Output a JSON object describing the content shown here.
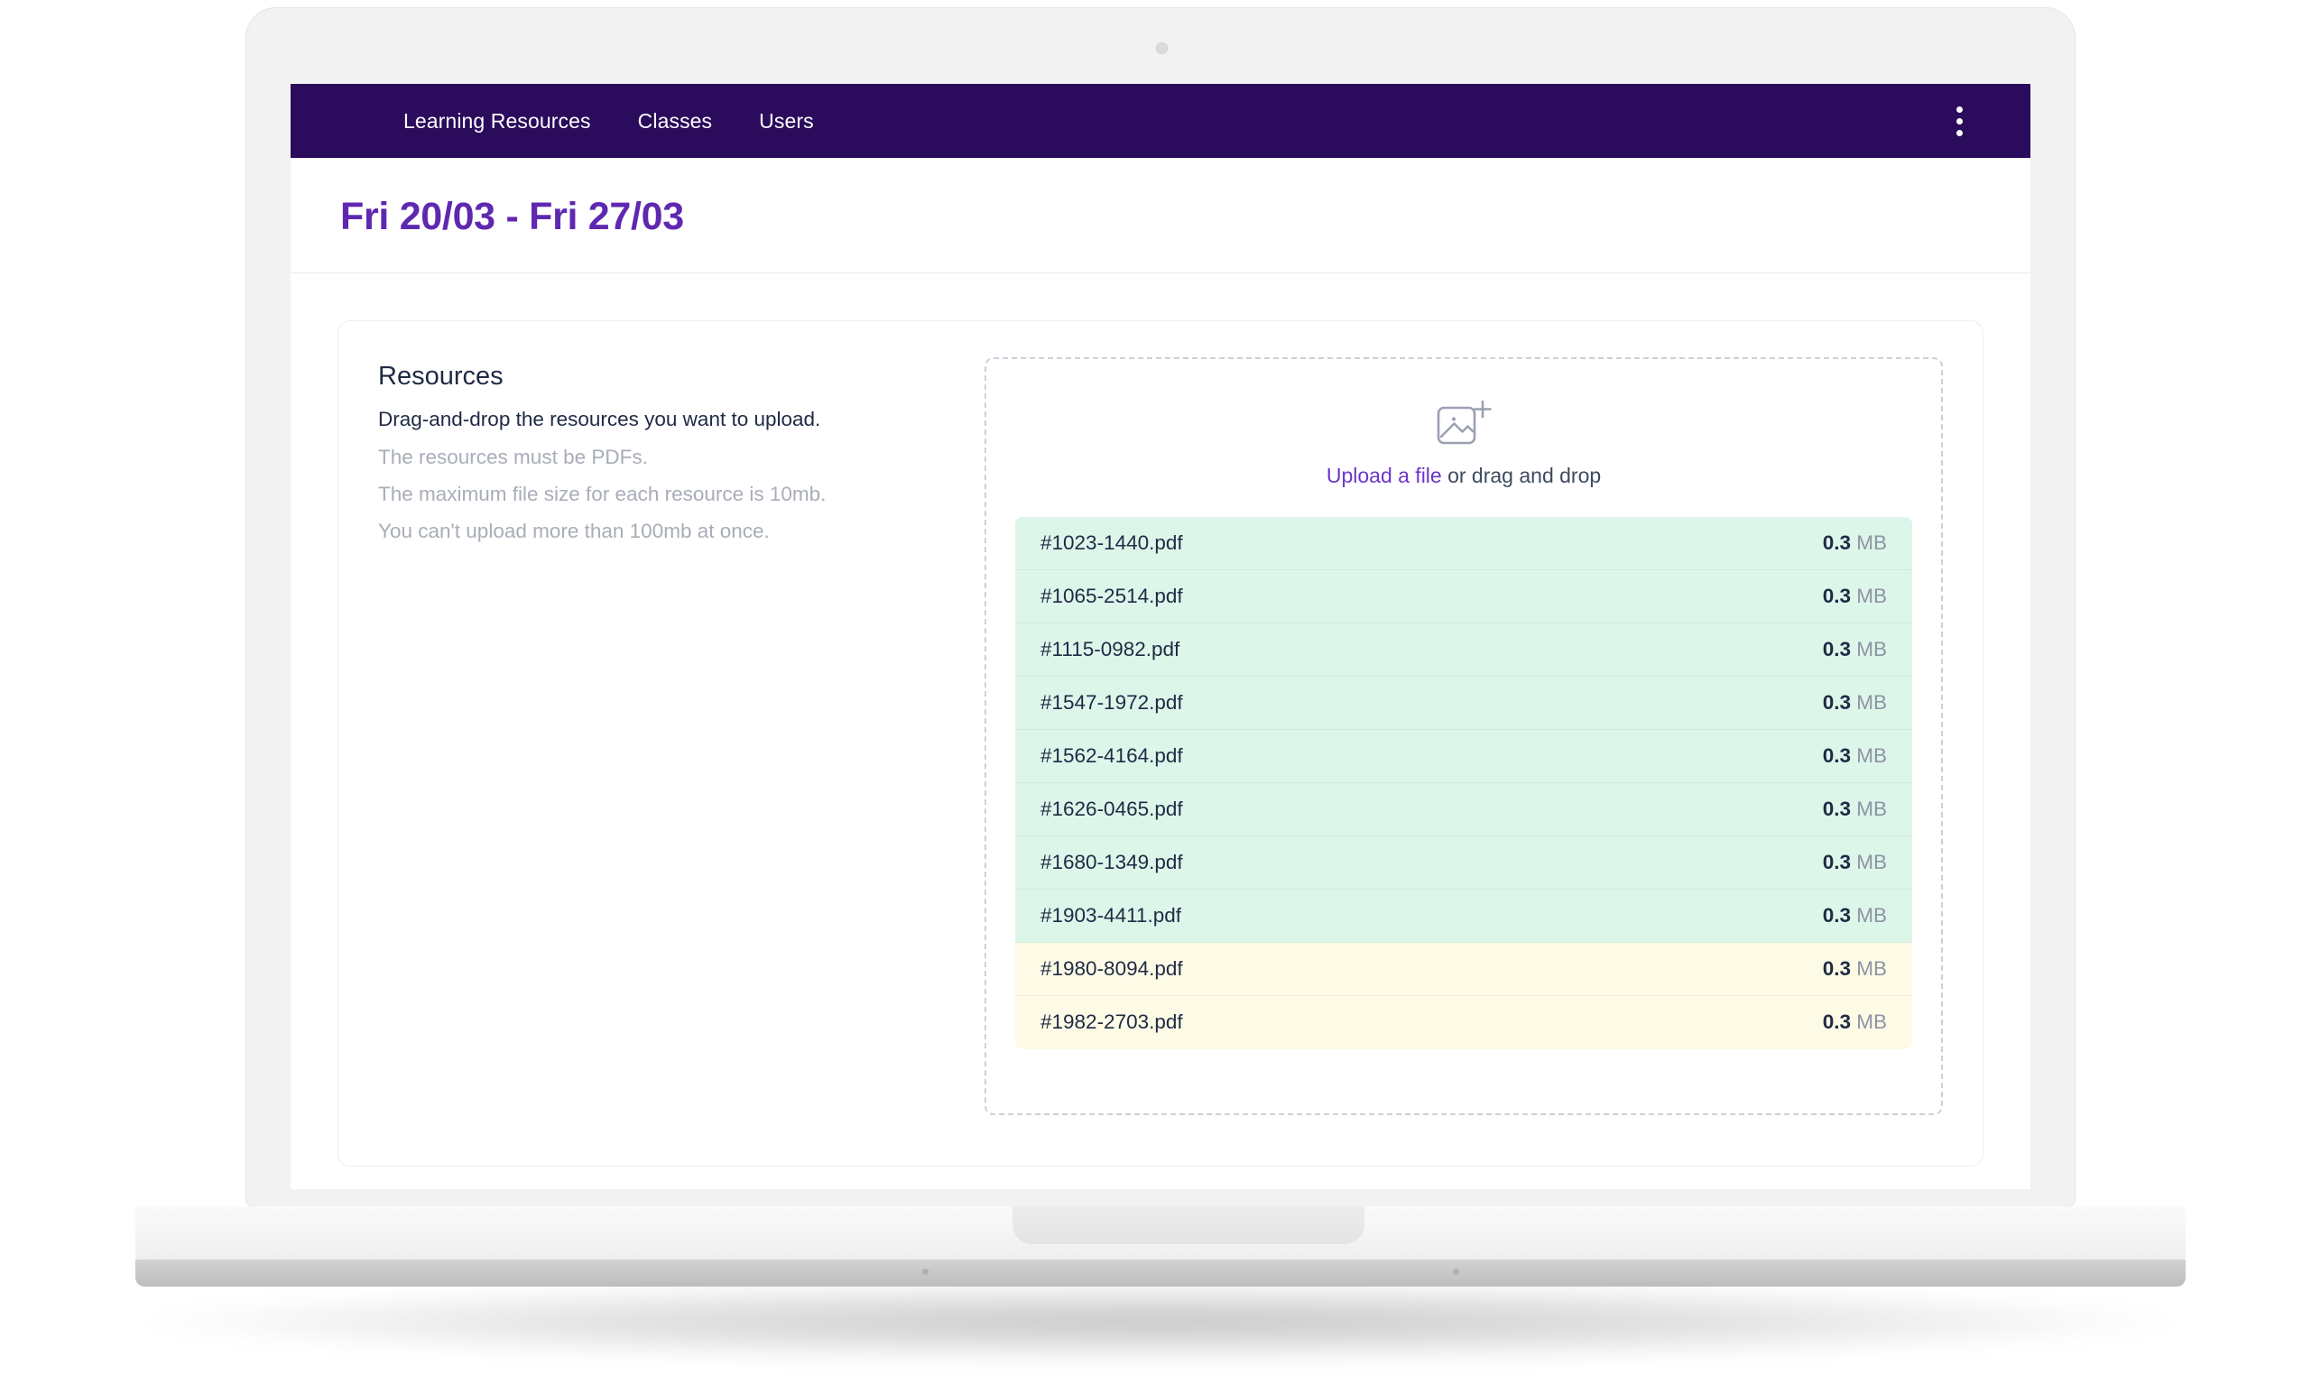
{
  "navbar": {
    "links": [
      {
        "label": "Learning Resources"
      },
      {
        "label": "Classes"
      },
      {
        "label": "Users"
      }
    ],
    "menu_icon": "kebab-menu-icon",
    "background_color": "#2b0b5c"
  },
  "header": {
    "title": "Fri 20/03 - Fri 27/03",
    "title_color": "#5f28b0"
  },
  "resources": {
    "section_title": "Resources",
    "hint_primary": "Drag-and-drop the resources you want to upload.",
    "hints": [
      "The resources must be PDFs.",
      "The maximum file size for each resource is 10mb.",
      "You can't upload more than 100mb at once."
    ]
  },
  "dropzone": {
    "icon": "image-plus-icon",
    "link_label": "Upload a file",
    "caption_rest": " or drag and drop",
    "link_color": "#6b35c9",
    "ok_row_color": "#ddf6ea",
    "warn_row_color": "#fdfbe6",
    "files": [
      {
        "name": "#1023-1440.pdf",
        "size_value": "0.3",
        "size_unit": "MB",
        "state": "ok"
      },
      {
        "name": "#1065-2514.pdf",
        "size_value": "0.3",
        "size_unit": "MB",
        "state": "ok"
      },
      {
        "name": "#1115-0982.pdf",
        "size_value": "0.3",
        "size_unit": "MB",
        "state": "ok"
      },
      {
        "name": "#1547-1972.pdf",
        "size_value": "0.3",
        "size_unit": "MB",
        "state": "ok"
      },
      {
        "name": "#1562-4164.pdf",
        "size_value": "0.3",
        "size_unit": "MB",
        "state": "ok"
      },
      {
        "name": "#1626-0465.pdf",
        "size_value": "0.3",
        "size_unit": "MB",
        "state": "ok"
      },
      {
        "name": "#1680-1349.pdf",
        "size_value": "0.3",
        "size_unit": "MB",
        "state": "ok"
      },
      {
        "name": "#1903-4411.pdf",
        "size_value": "0.3",
        "size_unit": "MB",
        "state": "ok"
      },
      {
        "name": "#1980-8094.pdf",
        "size_value": "0.3",
        "size_unit": "MB",
        "state": "warn"
      },
      {
        "name": "#1982-2703.pdf",
        "size_value": "0.3",
        "size_unit": "MB",
        "state": "warn"
      }
    ]
  }
}
